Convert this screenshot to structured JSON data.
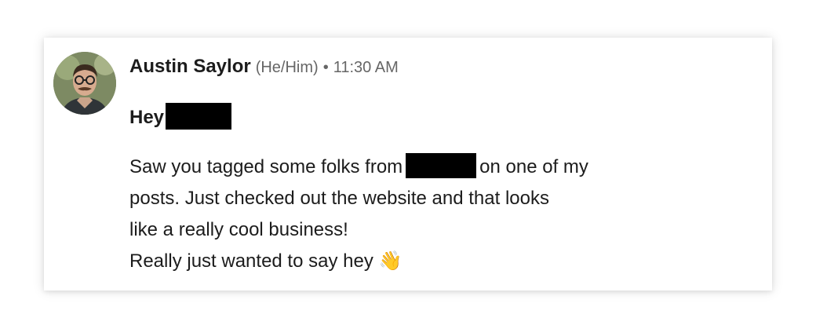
{
  "message": {
    "author": "Austin Saylor",
    "pronouns": "(He/Him)",
    "separator": "•",
    "time": "11:30 AM",
    "greeting": "Hey",
    "body": {
      "line1_before": "Saw you tagged some folks from",
      "line1_after": "on one of my",
      "line2": "posts. Just checked out the website and that looks",
      "line3": "like a really cool business!",
      "line4": "Really just wanted to say hey",
      "emoji": "👋"
    }
  },
  "icons": {
    "avatar": "author-avatar-photo",
    "redaction": "black-redaction-bar"
  }
}
